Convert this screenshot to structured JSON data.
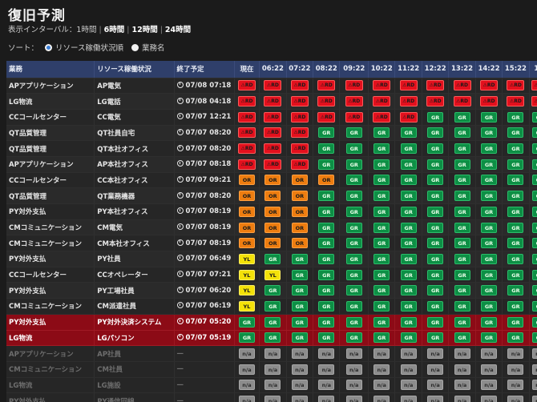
{
  "page": {
    "title": "復旧予測"
  },
  "interval": {
    "label": "表示インターバル：",
    "options": [
      {
        "label": "1時間",
        "active": false
      },
      {
        "label": "6時間",
        "active": true
      },
      {
        "label": "12時間",
        "active": true
      },
      {
        "label": "24時間",
        "active": true
      }
    ]
  },
  "sort": {
    "label": "ソート：",
    "options": [
      {
        "label": "リソース稼働状況順",
        "checked": true
      },
      {
        "label": "業務名",
        "checked": false
      }
    ]
  },
  "status_legend": {
    "rd": {
      "label": "RD",
      "color": "#e3101d"
    },
    "or": {
      "label": "OR",
      "color": "#ee7d10"
    },
    "yl": {
      "label": "YL",
      "color": "#f4e209"
    },
    "gr": {
      "label": "GR",
      "color": "#0d8f45"
    },
    "na": {
      "label": "n/a",
      "color": "#8c8c8c"
    }
  },
  "table": {
    "headers": [
      "業務",
      "リソース稼働状況",
      "終了予定",
      "現在",
      "06:22",
      "07:22",
      "08:22",
      "09:22",
      "10:22",
      "11:22",
      "12:22",
      "13:22",
      "14:22",
      "15:22",
      "16:"
    ],
    "rows": [
      {
        "business": "APアプリケーション",
        "resource": "AP電気",
        "end": "07/08 07:18",
        "style": "normal",
        "cells": [
          "rd",
          "rd",
          "rd",
          "rd",
          "rd",
          "rd",
          "rd",
          "rd",
          "rd",
          "rd",
          "rd",
          "rd"
        ]
      },
      {
        "business": "LG物流",
        "resource": "LG電話",
        "end": "07/08 04:18",
        "style": "alt",
        "cells": [
          "rd",
          "rd",
          "rd",
          "rd",
          "rd",
          "rd",
          "rd",
          "rd",
          "rd",
          "rd",
          "rd",
          "rd"
        ]
      },
      {
        "business": "CCコールセンター",
        "resource": "CC電気",
        "end": "07/07 12:21",
        "style": "normal",
        "cells": [
          "rd",
          "rd",
          "rd",
          "rd",
          "rd",
          "rd",
          "rd",
          "gr",
          "gr",
          "gr",
          "gr",
          "gr"
        ]
      },
      {
        "business": "QT品質管理",
        "resource": "QT社員自宅",
        "end": "07/07 08:20",
        "style": "alt",
        "cells": [
          "rd",
          "rd",
          "rd",
          "gr",
          "gr",
          "gr",
          "gr",
          "gr",
          "gr",
          "gr",
          "gr",
          "gr"
        ]
      },
      {
        "business": "QT品質管理",
        "resource": "QT本社オフィス",
        "end": "07/07 08:20",
        "style": "normal",
        "cells": [
          "rd",
          "rd",
          "rd",
          "gr",
          "gr",
          "gr",
          "gr",
          "gr",
          "gr",
          "gr",
          "gr",
          "gr"
        ]
      },
      {
        "business": "APアプリケーション",
        "resource": "AP本社オフィス",
        "end": "07/07 08:18",
        "style": "alt",
        "cells": [
          "rd",
          "rd",
          "rd",
          "gr",
          "gr",
          "gr",
          "gr",
          "gr",
          "gr",
          "gr",
          "gr",
          "gr"
        ]
      },
      {
        "business": "CCコールセンター",
        "resource": "CC本社オフィス",
        "end": "07/07 09:21",
        "style": "normal",
        "cells": [
          "or",
          "or",
          "or",
          "or",
          "gr",
          "gr",
          "gr",
          "gr",
          "gr",
          "gr",
          "gr",
          "gr"
        ]
      },
      {
        "business": "QT品質管理",
        "resource": "QT業務機器",
        "end": "07/07 08:20",
        "style": "alt",
        "cells": [
          "or",
          "or",
          "or",
          "gr",
          "gr",
          "gr",
          "gr",
          "gr",
          "gr",
          "gr",
          "gr",
          "gr"
        ]
      },
      {
        "business": "PY対外支払",
        "resource": "PY本社オフィス",
        "end": "07/07 08:19",
        "style": "normal",
        "cells": [
          "or",
          "or",
          "or",
          "gr",
          "gr",
          "gr",
          "gr",
          "gr",
          "gr",
          "gr",
          "gr",
          "gr"
        ]
      },
      {
        "business": "CMコミュニケーション",
        "resource": "CM電気",
        "end": "07/07 08:19",
        "style": "alt",
        "cells": [
          "or",
          "or",
          "or",
          "gr",
          "gr",
          "gr",
          "gr",
          "gr",
          "gr",
          "gr",
          "gr",
          "gr"
        ]
      },
      {
        "business": "CMコミュニケーション",
        "resource": "CM本社オフィス",
        "end": "07/07 08:19",
        "style": "normal",
        "cells": [
          "or",
          "or",
          "or",
          "gr",
          "gr",
          "gr",
          "gr",
          "gr",
          "gr",
          "gr",
          "gr",
          "gr"
        ]
      },
      {
        "business": "PY対外支払",
        "resource": "PY社員",
        "end": "07/07 06:49",
        "style": "alt",
        "cells": [
          "yl",
          "gr",
          "gr",
          "gr",
          "gr",
          "gr",
          "gr",
          "gr",
          "gr",
          "gr",
          "gr",
          "gr"
        ]
      },
      {
        "business": "CCコールセンター",
        "resource": "CCオペレーター",
        "end": "07/07 07:21",
        "style": "normal",
        "cells": [
          "yl",
          "yl",
          "gr",
          "gr",
          "gr",
          "gr",
          "gr",
          "gr",
          "gr",
          "gr",
          "gr",
          "gr"
        ]
      },
      {
        "business": "PY対外支払",
        "resource": "PY工場社員",
        "end": "07/07 06:20",
        "style": "alt",
        "cells": [
          "yl",
          "gr",
          "gr",
          "gr",
          "gr",
          "gr",
          "gr",
          "gr",
          "gr",
          "gr",
          "gr",
          "gr"
        ]
      },
      {
        "business": "CMコミュニケーション",
        "resource": "CM派遣社員",
        "end": "07/07 06:19",
        "style": "normal",
        "cells": [
          "yl",
          "gr",
          "gr",
          "gr",
          "gr",
          "gr",
          "gr",
          "gr",
          "gr",
          "gr",
          "gr",
          "gr"
        ]
      },
      {
        "business": "PY対外支払",
        "resource": "PY対外決済システム",
        "end": "07/07 05:20",
        "style": "critical",
        "cells": [
          "gr",
          "gr",
          "gr",
          "gr",
          "gr",
          "gr",
          "gr",
          "gr",
          "gr",
          "gr",
          "gr",
          "gr"
        ]
      },
      {
        "business": "LG物流",
        "resource": "LGパソコン",
        "end": "07/07 05:19",
        "style": "critical",
        "cells": [
          "gr",
          "gr",
          "gr",
          "gr",
          "gr",
          "gr",
          "gr",
          "gr",
          "gr",
          "gr",
          "gr",
          "gr"
        ]
      },
      {
        "business": "APアプリケーション",
        "resource": "AP社員",
        "end": "—",
        "style": "inactive",
        "cells": [
          "na",
          "na",
          "na",
          "na",
          "na",
          "na",
          "na",
          "na",
          "na",
          "na",
          "na",
          "na"
        ]
      },
      {
        "business": "CMコミュニケーション",
        "resource": "CM社員",
        "end": "—",
        "style": "inactive",
        "cells": [
          "na",
          "na",
          "na",
          "na",
          "na",
          "na",
          "na",
          "na",
          "na",
          "na",
          "na",
          "na"
        ]
      },
      {
        "business": "LG物流",
        "resource": "LG施設",
        "end": "—",
        "style": "inactive",
        "cells": [
          "na",
          "na",
          "na",
          "na",
          "na",
          "na",
          "na",
          "na",
          "na",
          "na",
          "na",
          "na"
        ]
      },
      {
        "business": "PY対外支払",
        "resource": "PY通信回線",
        "end": "—",
        "style": "inactive",
        "cells": [
          "na",
          "na",
          "na",
          "na",
          "na",
          "na",
          "na",
          "na",
          "na",
          "na",
          "na",
          "na"
        ]
      }
    ]
  }
}
